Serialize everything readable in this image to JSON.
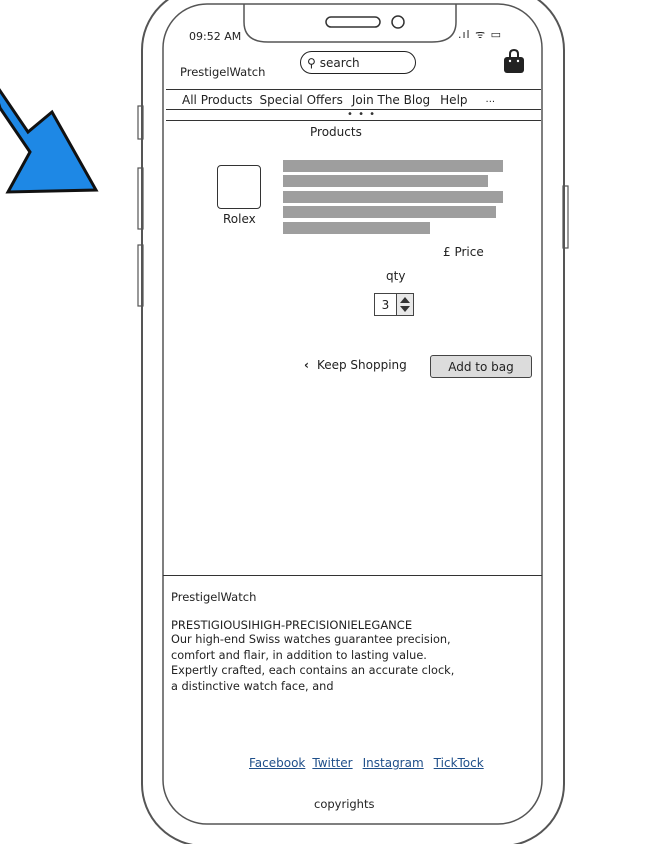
{
  "status_bar": {
    "time": "09:52 AM",
    "icons": ".ıl ᯤ ▭"
  },
  "header": {
    "brand": "PrestigelWatch",
    "search_placeholder": "search",
    "bag_icon": "shopping-bag-icon"
  },
  "nav": {
    "items": [
      "All Products",
      "Special Offers",
      "Join The Blog",
      "Help"
    ],
    "more": "...",
    "dots": "• • •"
  },
  "product": {
    "section_title": "Products",
    "thumbnail_label": "Rolex",
    "price": "£ Price",
    "qty_label": "qty",
    "qty_value": "3",
    "keep_shopping": "Keep Shopping",
    "add_to_bag": "Add to bag"
  },
  "footer": {
    "brand": "PrestigelWatch",
    "tagline": "PRESTIGIOUSIHIGH-PRECISIONIELEGANCE",
    "description": "Our high-end Swiss watches guarantee precision, comfort and flair, in addition to lasting value. Expertly crafted, each contains an accurate clock, a distinctive watch face, and",
    "links": [
      "Facebook",
      "Twitter",
      "Instagram",
      "TickTock"
    ],
    "copyright": "copyrights"
  },
  "colors": {
    "arrow": "#1e88e5",
    "placeholder_bar": "#9e9e9e",
    "link": "#1f4f8a",
    "button": "#dcdcdc"
  }
}
